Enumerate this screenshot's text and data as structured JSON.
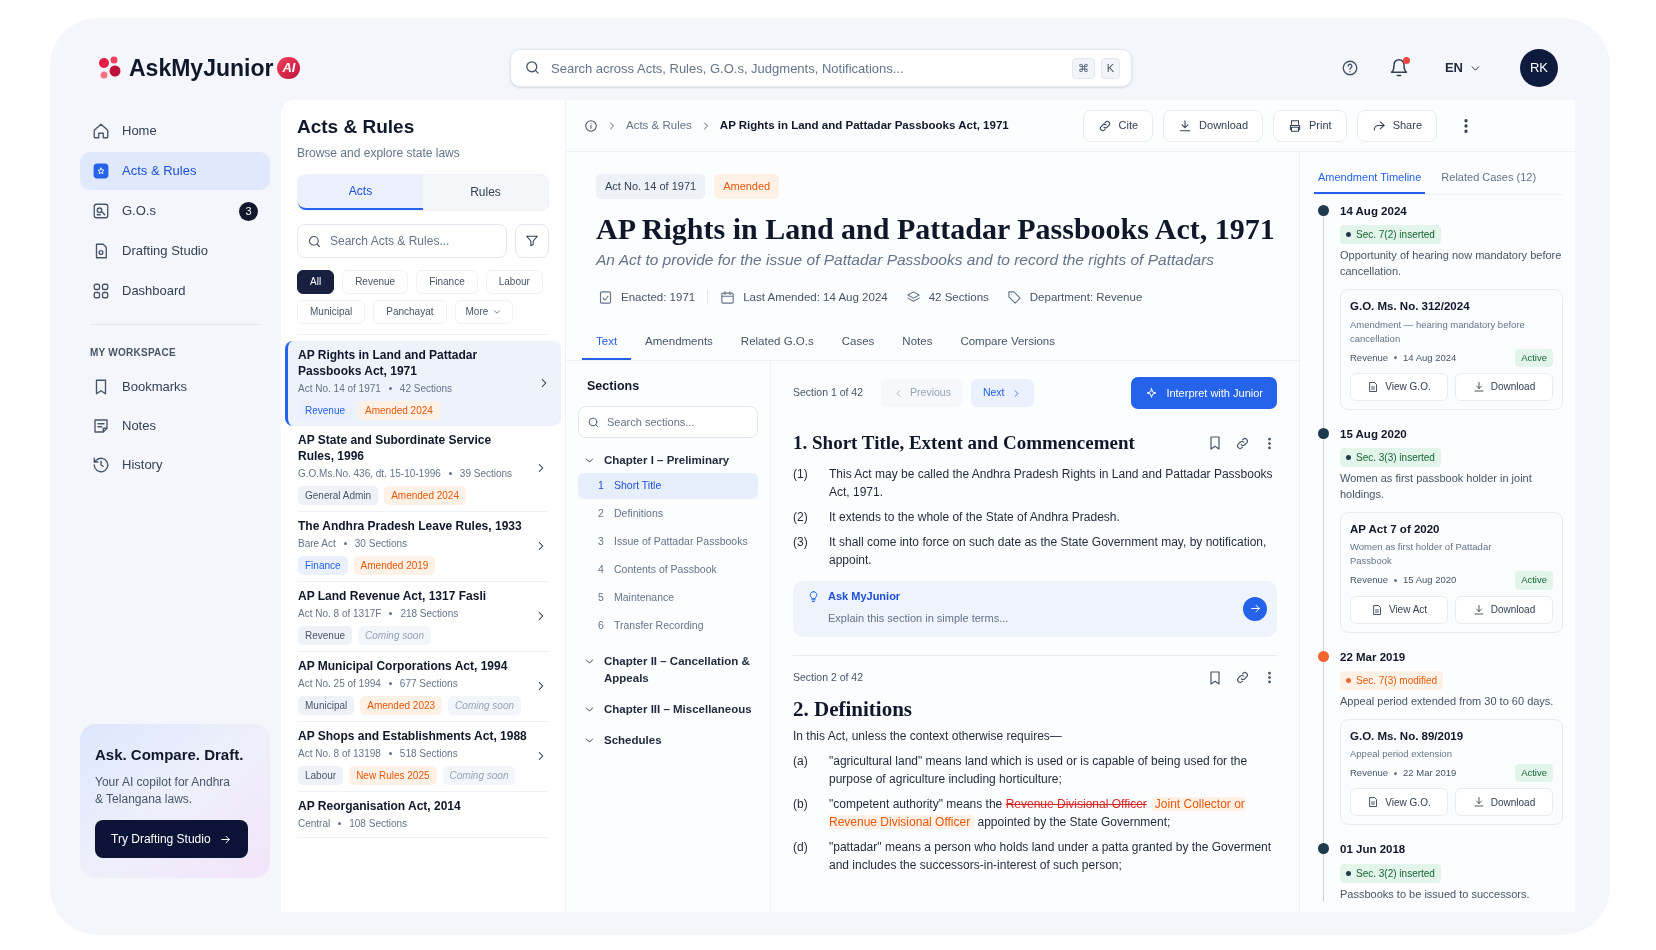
{
  "brand": {
    "name": "AskMyJunior",
    "badge": "AI"
  },
  "search": {
    "placeholder": "Search across Acts, Rules, G.O.s, Judgments, Notifications...",
    "shortcut": [
      "⌘",
      "K"
    ]
  },
  "header": {
    "language": "EN",
    "avatar": "RK",
    "unread": true
  },
  "sidebar": {
    "items": [
      {
        "label": "Home",
        "selected": false
      },
      {
        "label": "Acts & Rules",
        "selected": true
      },
      {
        "label": "G.O.s",
        "selected": false,
        "count": "3"
      },
      {
        "label": "Drafting Studio",
        "selected": false
      },
      {
        "label": "Dashboard",
        "selected": false
      }
    ],
    "workspace_heading": "MY WORKSPACE",
    "workspace_items": [
      {
        "label": "Bookmarks",
        "selected": false
      },
      {
        "label": "Notes",
        "selected": false
      },
      {
        "label": "History",
        "selected": false
      }
    ]
  },
  "promo": {
    "title": "Ask. Compare. Draft.",
    "text": "Your AI copilot for Andhra & Telangana laws.",
    "button": "Try Drafting Studio"
  },
  "list_panel": {
    "title": "Acts & Rules",
    "subtitle": "Browse and explore state laws",
    "tabs": [
      {
        "label": "Acts",
        "selected": true
      },
      {
        "label": "Rules",
        "selected": false
      }
    ],
    "search_placeholder": "Search Acts & Rules...",
    "filters": [
      {
        "label": "All",
        "selected": true
      },
      {
        "label": "Revenue",
        "selected": false
      },
      {
        "label": "Finance",
        "selected": false
      },
      {
        "label": "Labour",
        "selected": false
      },
      {
        "label": "Municipal",
        "selected": false
      },
      {
        "label": "Panchayat",
        "selected": false
      }
    ],
    "more": "More",
    "acts": [
      {
        "title": "AP Rights in Land and Pattadar Passbooks Act, 1971",
        "meta": [
          "Act No. 14 of 1971",
          "42 Sections"
        ],
        "selected": true,
        "tags": [
          {
            "label": "Revenue",
            "kind": "category-accent"
          },
          {
            "label": "Amended 2024",
            "kind": "amendment"
          }
        ]
      },
      {
        "title": "AP State and Subordinate Service Rules, 1996",
        "meta": [
          "G.O.Ms.No. 436, dt. 15-10-1996",
          "39 Sections"
        ],
        "selected": false,
        "tags": [
          {
            "label": "General Admin",
            "kind": "category"
          },
          {
            "label": "Amended 2024",
            "kind": "amendment"
          }
        ]
      },
      {
        "title": "The Andhra Pradesh Leave Rules, 1933",
        "meta": [
          "Bare Act",
          "30 Sections"
        ],
        "selected": false,
        "tags": [
          {
            "label": "Finance",
            "kind": "category-accent"
          },
          {
            "label": "Amended 2019",
            "kind": "amendment"
          }
        ]
      },
      {
        "title": "AP Land Revenue Act, 1317 Fasli",
        "meta": [
          "Act No. 8 of 1317F",
          "218 Sections"
        ],
        "selected": false,
        "tags": [
          {
            "label": "Revenue",
            "kind": "category"
          },
          {
            "label": "Coming soon",
            "kind": "upcoming"
          }
        ]
      },
      {
        "title": "AP Municipal Corporations Act, 1994",
        "meta": [
          "Act No. 25 of 1994",
          "677 Sections"
        ],
        "selected": false,
        "tags": [
          {
            "label": "Municipal",
            "kind": "category"
          },
          {
            "label": "Amended 2023",
            "kind": "amendment"
          },
          {
            "label": "Coming soon",
            "kind": "upcoming"
          }
        ]
      },
      {
        "title": "AP Shops and Establishments Act, 1988",
        "meta": [
          "Act No. 8 of 13198",
          "518 Sections"
        ],
        "selected": false,
        "tags": [
          {
            "label": "Labour",
            "kind": "category"
          },
          {
            "label": "New Rules 2025",
            "kind": "amendment"
          },
          {
            "label": "Coming soon",
            "kind": "upcoming"
          }
        ]
      },
      {
        "title": "AP Reorganisation Act, 2014",
        "meta": [
          "Central",
          "108 Sections"
        ],
        "selected": false
      }
    ]
  },
  "breadcrumb": [
    "Acts & Rules",
    "AP Rights in Land and Pattadar Passbooks Act, 1971"
  ],
  "actions": [
    "Cite",
    "Download",
    "Print",
    "Share"
  ],
  "document": {
    "badges": [
      {
        "label": "Act No. 14 of 1971",
        "kind": "number"
      },
      {
        "label": "Amended",
        "kind": "status"
      }
    ],
    "title": "AP Rights in Land and Pattadar Passbooks Act, 1971",
    "subtitle": "An Act to provide for the issue of Pattadar Passbooks and to record the rights of Pattadars",
    "meta": [
      "Enacted: 1971",
      "Last Amended: 14 Aug 2024",
      "42 Sections",
      "Department: Revenue"
    ],
    "tabs": [
      {
        "label": "Text",
        "selected": true
      },
      {
        "label": "Amendments",
        "selected": false
      },
      {
        "label": "Related G.O.s",
        "selected": false
      },
      {
        "label": "Cases",
        "selected": false
      },
      {
        "label": "Notes",
        "selected": false
      },
      {
        "label": "Compare Versions",
        "selected": false
      }
    ]
  },
  "sections_nav": {
    "title": "Sections",
    "search_placeholder": "Search sections...",
    "chapters": [
      {
        "label": "Chapter I – Preliminary",
        "children": [
          {
            "number": "1",
            "label": "Short Title",
            "selected": true
          },
          {
            "number": "2",
            "label": "Definitions",
            "selected": false
          },
          {
            "number": "3",
            "label": "Issue of Pattadar Passbooks",
            "selected": false
          },
          {
            "number": "4",
            "label": "Contents of Passbook",
            "selected": false
          },
          {
            "number": "5",
            "label": "Maintenance",
            "selected": false
          },
          {
            "number": "6",
            "label": "Transfer Recording",
            "selected": false
          }
        ]
      },
      {
        "label": "Chapter II – Cancellation & Appeals"
      },
      {
        "label": "Chapter III – Miscellaneous"
      },
      {
        "label": "Schedules"
      }
    ]
  },
  "reader": {
    "position": "Section 1 of 42",
    "previous": {
      "label": "Previous",
      "disabled": true
    },
    "next": {
      "label": "Next",
      "disabled": false
    },
    "interpret_button": "Interpret with Junior",
    "section1": {
      "heading": "1. Short Title, Extent and Commencement",
      "clauses": [
        {
          "label": "(1)",
          "segments": [
            {
              "text": "This Act may be called the Andhra Pradesh Rights in Land and Pattadar Passbooks Act, 1971.",
              "kind": "plain"
            }
          ]
        },
        {
          "label": "(2)",
          "segments": [
            {
              "text": "It extends to the whole of the State of Andhra Pradesh.",
              "kind": "plain"
            }
          ]
        },
        {
          "label": "(3)",
          "segments": [
            {
              "text": "It shall come into force on such date as the State Government may, by notification, appoint.",
              "kind": "plain"
            }
          ]
        }
      ]
    },
    "ask": {
      "title": "Ask MyJunior",
      "placeholder": "Explain this section in simple terms..."
    },
    "section2": {
      "position": "Section 2 of 42",
      "heading": "2. Definitions",
      "intro": "In this Act, unless the context otherwise requires—",
      "clauses": [
        {
          "label": "(a)",
          "segments": [
            {
              "text": "\"agricultural land\" means land which is used or is capable of being used for the purpose of agriculture including horticulture;",
              "kind": "plain"
            }
          ]
        },
        {
          "label": "(b)",
          "segments": [
            {
              "text": "\"competent authority\" means the ",
              "kind": "plain"
            },
            {
              "text": "Revenue Divisional Officer",
              "kind": "deleted"
            },
            {
              "text": "Joint Collector or Revenue Divisional Officer",
              "kind": "inserted"
            },
            {
              "text": " appointed by the State Government;",
              "kind": "plain"
            }
          ]
        },
        {
          "label": "(d)",
          "segments": [
            {
              "text": "\"pattadar\" means a person who holds land under a patta granted by the Goverment and includes the successors-in-interest of such person;",
              "kind": "plain"
            }
          ]
        }
      ]
    }
  },
  "right_panel": {
    "tabs": [
      {
        "label": "Amendment Timeline",
        "selected": true
      },
      {
        "label": "Related Cases (12)",
        "selected": false
      }
    ],
    "timeline": [
      {
        "date": "14 Aug 2024",
        "change": "Sec. 7(2) inserted",
        "kind": "inserted",
        "description": "Opportunity of hearing now mandatory before cancellation.",
        "document": {
          "title": "G.O. Ms. No. 312/2024",
          "summary": "Amendment — hearing mandatory before cancellation",
          "department": "Revenue",
          "date": "14 Aug 2024",
          "status": "Active",
          "buttons": [
            "View G.O.",
            "Download"
          ]
        }
      },
      {
        "date": "15 Aug 2020",
        "change": "Sec. 3(3) inserted",
        "kind": "inserted",
        "description": "Women as first passbook holder in joint holdings.",
        "document": {
          "title": "AP Act 7 of 2020",
          "summary": "Women as first holder of Pattadar Passbook",
          "department": "Revenue",
          "date": "15 Aug 2020",
          "status": "Active",
          "buttons": [
            "View Act",
            "Download"
          ]
        }
      },
      {
        "date": "22 Mar 2019",
        "change": "Sec. 7(3) modified",
        "kind": "modified",
        "description": "Appeal period extended from 30 to 60 days.",
        "document": {
          "title": "G.O. Ms. No. 89/2019",
          "summary": "Appeal period extension",
          "department": "Revenue",
          "date": "22 Mar 2019",
          "status": "Active",
          "buttons": [
            "View G.O.",
            "Download"
          ]
        }
      },
      {
        "date": "01 Jun 2018",
        "change": "Sec. 3(2) inserted",
        "kind": "inserted",
        "description": "Passbooks to be issued to successors."
      }
    ]
  }
}
